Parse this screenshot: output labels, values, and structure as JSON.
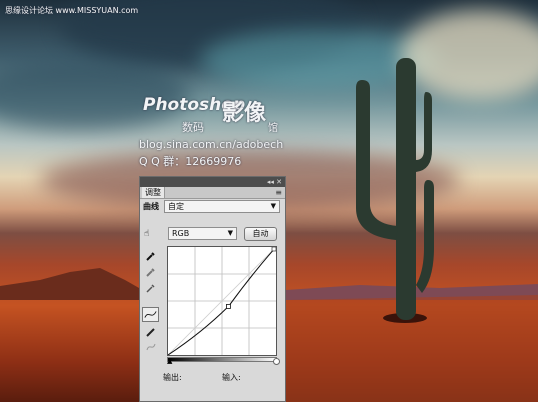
{
  "watermark": {
    "top_left_site": "思缘设计论坛 www.MISSYUAN.com",
    "brand_name": "Photoshop",
    "brand_big": "影像",
    "brand_small": "数码",
    "brand_suffix": "馆",
    "blog": "blog.sina.com.cn/adobech",
    "qq": "Q Q 群：12669976"
  },
  "panel": {
    "title_controls": "◂◂ ✕",
    "tab": "调整",
    "curves_label": "曲线",
    "preset_value": "自定",
    "channel_value": "RGB",
    "auto_button": "自动",
    "output_label": "输出:",
    "input_label": "输入:",
    "curve": {
      "point": [
        0.56,
        0.45
      ]
    }
  },
  "colors": {
    "panel_bg": "#d9d9d9",
    "titlebar": "#4d4d4d"
  }
}
